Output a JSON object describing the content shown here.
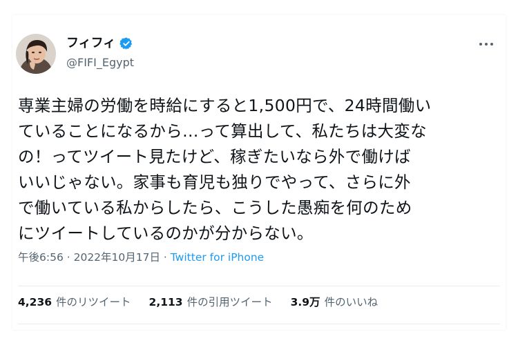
{
  "user": {
    "display_name": "フィフィ",
    "handle": "@FIFI_Egypt",
    "verified": true
  },
  "more_icon": "more-horizontal-icon",
  "tweet": {
    "text": "専業主婦の労働を時給にすると1,500円で、24時間働い\nていることになるから…って算出して、私たちは大変な\nの！ってツイート見たけど、稼ぎたいなら外で働けば\nいいじゃない。家事も育児も独りでやって、さらに外\nで働いている私からしたら、こうした愚痴を何のため\nにツイートしているのかが分からない。"
  },
  "meta": {
    "time": "午後6:56",
    "separator1": " · ",
    "date": "2022年10月17日",
    "separator2": " · ",
    "source": "Twitter for iPhone"
  },
  "stats": {
    "retweets_count": "4,236",
    "retweets_label": "件のリツイート",
    "quotes_count": "2,113",
    "quotes_label": "件の引用ツイート",
    "likes_count": "3.9万",
    "likes_label": "件のいいね"
  },
  "colors": {
    "text": "#0f1419",
    "secondary": "#536471",
    "accent": "#1d9bf0",
    "divider": "#e6ecf0"
  }
}
